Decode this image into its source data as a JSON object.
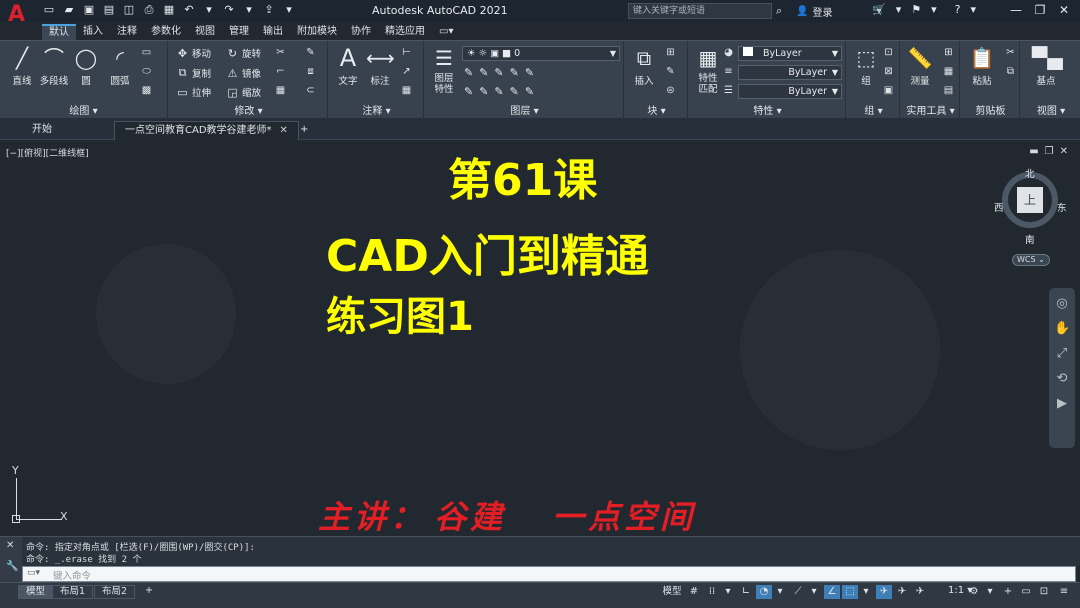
{
  "titlebar": {
    "app_title": "Autodesk AutoCAD 2021",
    "search_placeholder": "键入关键字或短语",
    "login_label": "登录",
    "logo": "A"
  },
  "ribbon_tabs": [
    "默认",
    "插入",
    "注释",
    "参数化",
    "视图",
    "管理",
    "输出",
    "附加模块",
    "协作",
    "精选应用"
  ],
  "ribbon": {
    "draw": {
      "label": "绘图 ▾",
      "big": [
        "直线",
        "多段线",
        "圆",
        "圆弧"
      ]
    },
    "modify": {
      "label": "修改 ▾",
      "items": [
        "移动",
        "旋转",
        "复制",
        "镜像",
        "拉伸",
        "缩放"
      ]
    },
    "annotation": {
      "label": "注释 ▾",
      "big": [
        "文字",
        "标注"
      ]
    },
    "layers": {
      "label": "图层 ▾",
      "big": "图层\n特性",
      "layer_value": "0"
    },
    "block": {
      "label": "块 ▾",
      "big": "插入"
    },
    "properties": {
      "label": "特性 ▾",
      "big": "特性\n匹配",
      "combos": [
        "ByLayer",
        "ByLayer",
        "ByLayer"
      ]
    },
    "groups": {
      "label": "组 ▾",
      "big": "组"
    },
    "utilities": {
      "label": "实用工具 ▾",
      "big": "测量"
    },
    "clipboard": {
      "label": "剪贴板",
      "big": "粘贴"
    },
    "view": {
      "label": "视图 ▾",
      "big": "基点"
    }
  },
  "doc_tabs": [
    {
      "label": "开始"
    },
    {
      "label": "一点空间教育CAD教学谷建老师*"
    }
  ],
  "canvas": {
    "view_label": "[−][俯视][二维线框]",
    "line1": "第61课",
    "line2": "CAD入门到精通",
    "line3": "练习图1",
    "lecturer_parts": [
      "主讲：",
      "谷建",
      "一点空间"
    ],
    "viewcube": {
      "north": "北",
      "south": "南",
      "west": "西",
      "east": "东",
      "face": "上"
    },
    "wcs_label": "WCS ⌄",
    "ucs_y": "Y",
    "ucs_x": "X"
  },
  "command": {
    "history": [
      "命令: 指定对角点或 [栏选(F)/圈围(WP)/圈交(CP)]:",
      "命令: _.erase 找到 2 个"
    ],
    "placeholder": "键入命令"
  },
  "status": {
    "layout_tabs": [
      "模型",
      "布局1",
      "布局2"
    ],
    "add_tab": "+",
    "scale": "1:1 ▾"
  },
  "colors": {
    "accent_text": "#ffff00",
    "lecturer_text": "#e31e24",
    "logo": "#d8212b",
    "canvas_bg": "#212830"
  }
}
